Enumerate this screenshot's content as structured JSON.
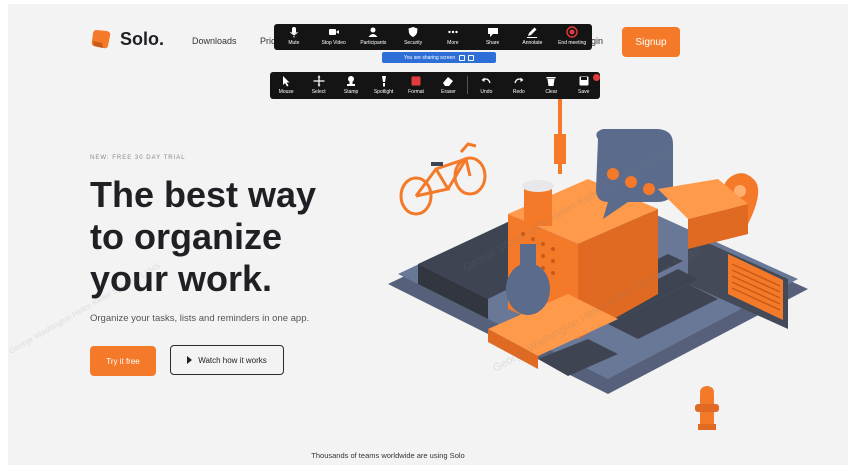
{
  "site": {
    "brand": "Solo.",
    "nav": {
      "downloads": "Downloads",
      "pricing": "Pric",
      "login": "gin"
    },
    "signup_label": "Signup"
  },
  "meeting_toolbar": {
    "items": [
      {
        "label": "Mute",
        "icon": "microphone-icon"
      },
      {
        "label": "Stop Video",
        "icon": "video-camera-icon"
      },
      {
        "label": "Participants",
        "icon": "participants-icon"
      },
      {
        "label": "Security",
        "icon": "shield-icon"
      },
      {
        "label": "More",
        "icon": "more-dots-icon"
      },
      {
        "label": "Share",
        "icon": "share-icon"
      },
      {
        "label": "Annotate",
        "icon": "pencil-icon"
      },
      {
        "label": "End meeting",
        "icon": "record-stop-icon"
      }
    ],
    "share_notice": "You are sharing screen"
  },
  "annotation_toolbar": {
    "items": [
      {
        "label": "Mouse",
        "icon": "cursor-icon"
      },
      {
        "label": "Select",
        "icon": "move-icon"
      },
      {
        "label": "Stamp",
        "icon": "stamp-icon"
      },
      {
        "label": "Spotlight",
        "icon": "spotlight-icon"
      },
      {
        "label": "Format",
        "icon": "format-icon"
      },
      {
        "label": "Eraser",
        "icon": "eraser-icon"
      },
      {
        "label": "Undo",
        "icon": "undo-icon"
      },
      {
        "label": "Redo",
        "icon": "redo-icon"
      },
      {
        "label": "Clear",
        "icon": "trash-icon"
      },
      {
        "label": "Save",
        "icon": "save-icon"
      }
    ]
  },
  "hero": {
    "eyebrow": "NEW: FREE 30 DAY TRIAL",
    "headline_lines": [
      "The best way",
      "to organize",
      "your work."
    ],
    "subtext": "Organize your tasks, lists and reminders in one app.",
    "try_label": "Try it free",
    "watch_label": "Watch how it works"
  },
  "footer_text": "Thousands of teams worldwide are using Solo",
  "watermark_text": "George Washington Helen Keller Speaker 12345",
  "colors": {
    "accent": "#f47a2a",
    "slate": "#5b6b8c",
    "dark": "#1f1f24",
    "toolbar": "#141414"
  }
}
